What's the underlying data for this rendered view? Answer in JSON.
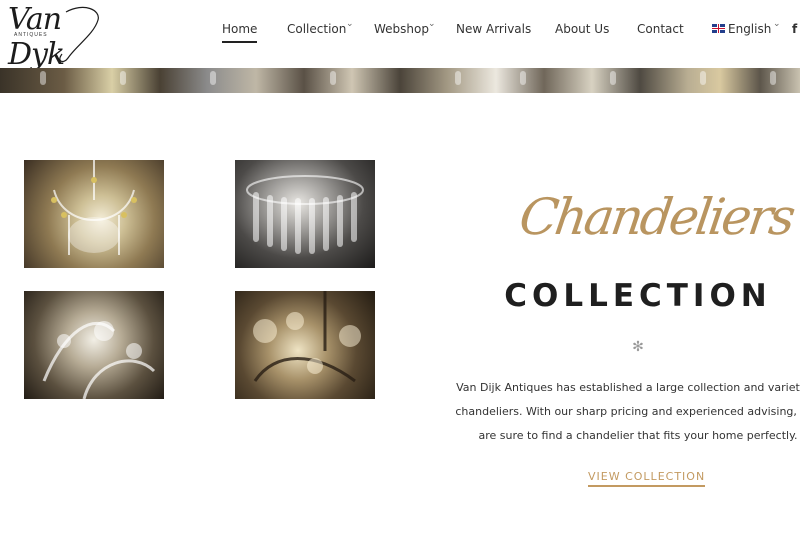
{
  "header": {
    "logo": {
      "name": "Van Dyk",
      "tagline": "ANTIQUES"
    },
    "nav": [
      {
        "label": "Home",
        "active": true,
        "has_dropdown": false
      },
      {
        "label": "Collection",
        "active": false,
        "has_dropdown": true
      },
      {
        "label": "Webshop",
        "active": false,
        "has_dropdown": true
      },
      {
        "label": "New Arrivals",
        "active": false,
        "has_dropdown": false
      },
      {
        "label": "About Us",
        "active": false,
        "has_dropdown": false
      },
      {
        "label": "Contact",
        "active": false,
        "has_dropdown": false
      }
    ],
    "language": {
      "label": "English",
      "icon": "uk-flag-icon",
      "has_dropdown": true
    },
    "social_icon": "facebook-icon",
    "social_label": "f",
    "caret_glyph": "⌄"
  },
  "hero": {
    "script_title": "Chandeliers",
    "title": "COLLECTION",
    "divider_icon": "asterisk-icon",
    "divider_glyph": "✻",
    "description": "Van Dijk Antiques has established a large collection and variety in chandeliers. With our sharp pricing and experienced advising, you are sure to find a chandelier that fits your home perfectly.",
    "cta_label": "VIEW COLLECTION"
  },
  "photos": [
    {
      "name": "chandelier-photo-1"
    },
    {
      "name": "chandelier-photo-2"
    },
    {
      "name": "chandelier-photo-3"
    },
    {
      "name": "chandelier-photo-4"
    }
  ],
  "colors": {
    "accent": "#c39a61",
    "script": "#b99560",
    "text": "#333333",
    "heading": "#1f1f1f"
  }
}
